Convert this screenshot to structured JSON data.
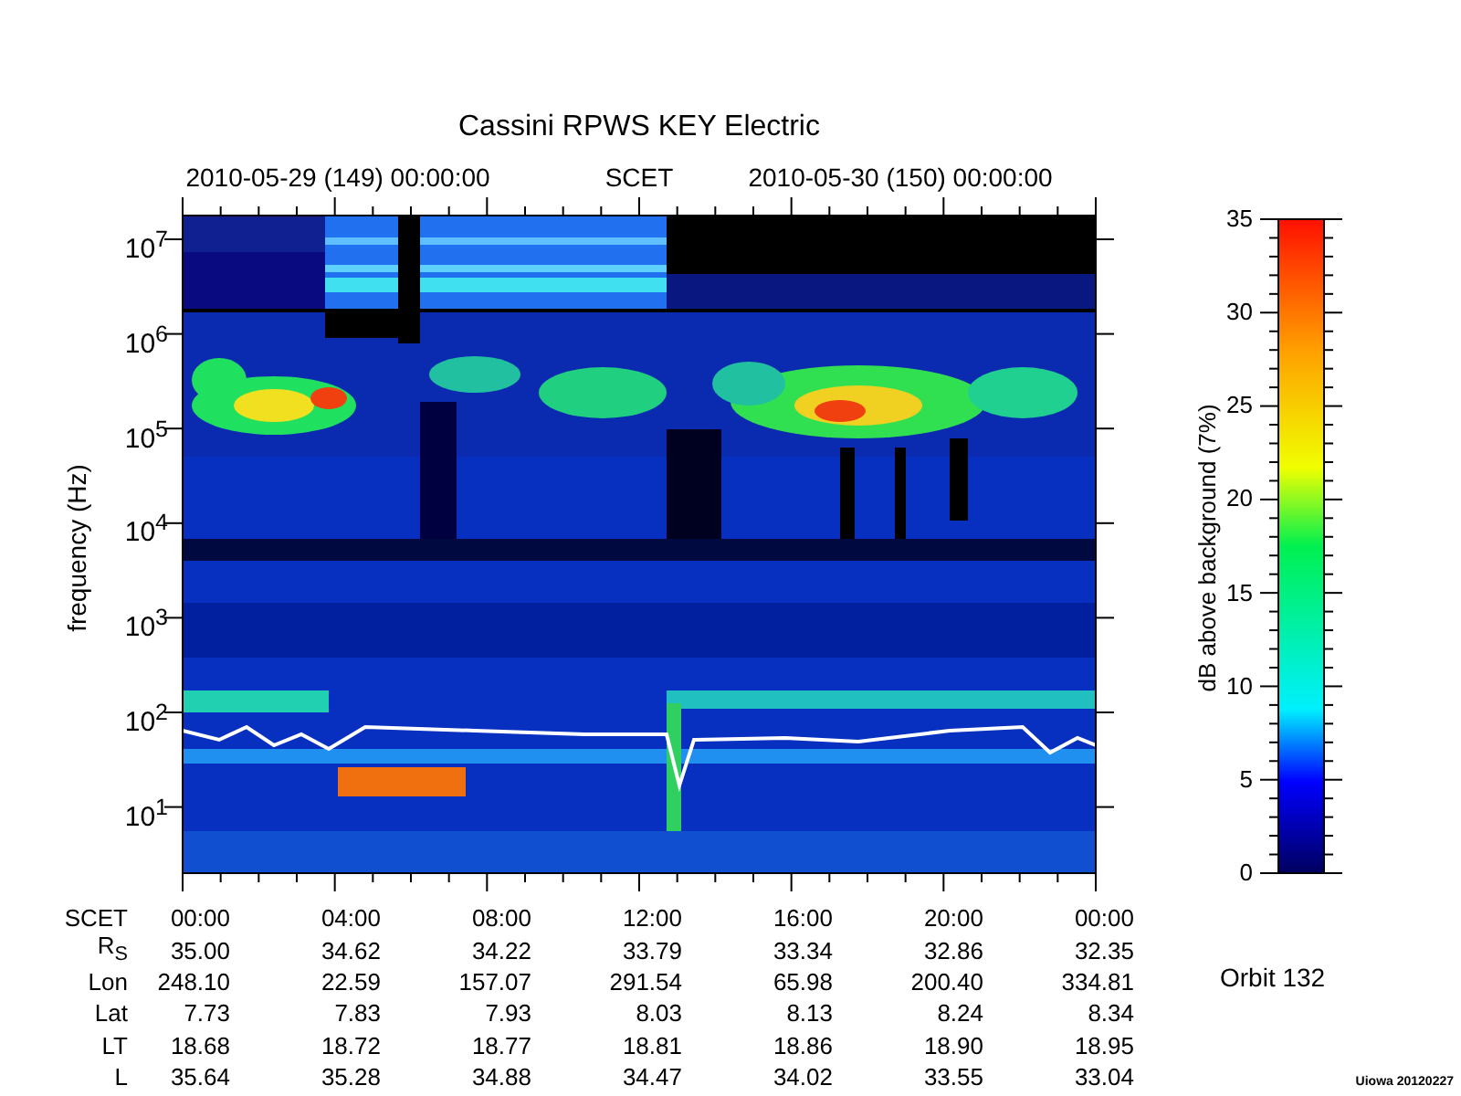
{
  "title": "Cassini RPWS KEY Electric",
  "header_labels": [
    "2010-05-29 (149) 00:00:00",
    "SCET",
    "2010-05-30 (150) 00:00:00"
  ],
  "y_axis": {
    "label": "frequency (Hz)",
    "ticks": [
      "10$^{7}$",
      "10$^{6}$",
      "10$^{5}$",
      "10$^{4}$",
      "10$^{3}$",
      "10$^{2}$",
      "10$^{1}$"
    ]
  },
  "colorbar": {
    "label": "dB above background (7%)",
    "ticks": [
      "35",
      "30",
      "25",
      "20",
      "15",
      "10",
      "5",
      "0"
    ]
  },
  "ephemeris": [
    {
      "label": "SCET",
      "values": [
        "00:00",
        "04:00",
        "08:00",
        "12:00",
        "16:00",
        "20:00",
        "00:00"
      ]
    },
    {
      "label": "R$_{S}$",
      "values": [
        "35.00",
        "34.62",
        "34.22",
        "33.79",
        "33.34",
        "32.86",
        "32.35"
      ]
    },
    {
      "label": "Lon",
      "values": [
        "248.10",
        "22.59",
        "157.07",
        "291.54",
        "65.98",
        "200.40",
        "334.81"
      ]
    },
    {
      "label": "Lat",
      "values": [
        "7.73",
        "7.83",
        "7.93",
        "8.03",
        "8.13",
        "8.24",
        "8.34"
      ]
    },
    {
      "label": "LT",
      "values": [
        "18.68",
        "18.72",
        "18.77",
        "18.81",
        "18.86",
        "18.90",
        "18.95"
      ]
    },
    {
      "label": "L",
      "values": [
        "35.64",
        "35.28",
        "34.88",
        "34.47",
        "34.02",
        "33.55",
        "33.04"
      ]
    }
  ],
  "orbit": "Orbit 132",
  "credit": "Uiowa 20120227"
}
